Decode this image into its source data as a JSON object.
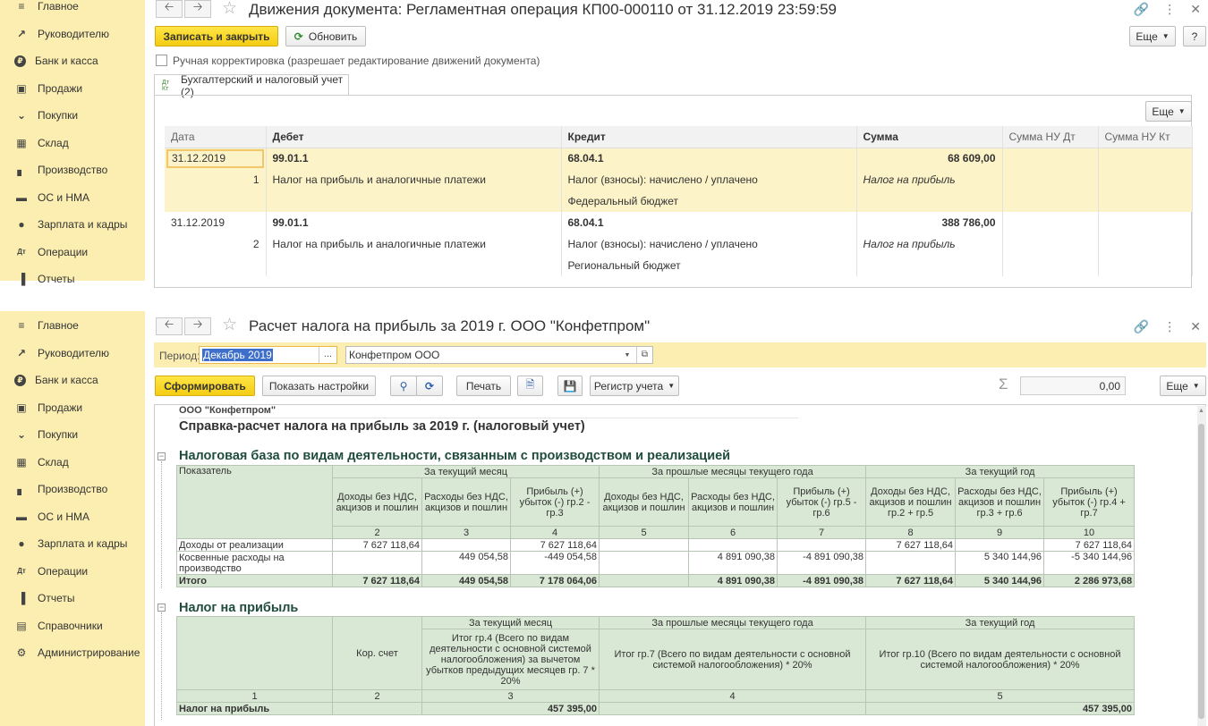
{
  "sidebar_top": [
    "Главное",
    "Руководителю",
    "Банк и касса",
    "Продажи",
    "Покупки",
    "Склад",
    "Производство",
    "ОС и НМА",
    "Зарплата и кадры",
    "Операции",
    "Отчеты"
  ],
  "sidebar_bottom": [
    "Главное",
    "Руководителю",
    "Банк и касса",
    "Продажи",
    "Покупки",
    "Склад",
    "Производство",
    "ОС и НМА",
    "Зарплата и кадры",
    "Операции",
    "Отчеты",
    "Справочники",
    "Администрирование"
  ],
  "icons": [
    "menu-icon",
    "trend-icon",
    "ruble-icon",
    "bag-icon",
    "cart-icon",
    "grid-icon",
    "factory-icon",
    "truck-icon",
    "person-icon",
    "dt-kt-icon",
    "bar-chart-icon",
    "book-icon",
    "gear-icon"
  ],
  "top": {
    "title": "Движения документа: Регламентная операция КП00-000110 от 31.12.2019 23:59:59",
    "save_close": "Записать и закрыть",
    "refresh": "Обновить",
    "more": "Еще",
    "help": "?",
    "manual_checkbox_label": "Ручная корректировка (разрешает редактирование движений документа)",
    "tab_label": "Бухгалтерский и налоговый учет (2)",
    "tab_icon": "Дт Кт",
    "grid_more": "Еще",
    "columns": [
      "Дата",
      "Дебет",
      "Кредит",
      "Сумма",
      "Сумма НУ Дт",
      "Сумма НУ Кт"
    ],
    "rows": [
      {
        "date": "31.12.2019",
        "debit": "99.01.1",
        "credit": "68.04.1",
        "sum": "68 609,00",
        "num": "1",
        "debit_sub": "Налог на прибыль и аналогичные платежи",
        "credit_sub1": "Налог (взносы): начислено / уплачено",
        "credit_sub2": "Федеральный бюджет",
        "sum_sub": "Налог на прибыль"
      },
      {
        "date": "31.12.2019",
        "debit": "99.01.1",
        "credit": "68.04.1",
        "sum": "388 786,00",
        "num": "2",
        "debit_sub": "Налог на прибыль и аналогичные платежи",
        "credit_sub1": "Налог (взносы): начислено / уплачено",
        "credit_sub2": "Региональный бюджет",
        "sum_sub": "Налог на прибыль"
      }
    ]
  },
  "bottom": {
    "title": "Расчет налога на прибыль за 2019 г. ООО \"Конфетпром\"",
    "period_label": "Период:",
    "period_value": "Декабрь 2019",
    "org_value": "Конфетпром ООО",
    "form_btn": "Сформировать",
    "settings_btn": "Показать настройки",
    "print_btn": "Печать",
    "register_btn": "Регистр учета",
    "sum_value": "0,00",
    "more": "Еще",
    "report": {
      "org": "ООО \"Конфетпром\"",
      "heading": "Справка-расчет налога на прибыль за 2019 г. (налоговый учет)",
      "section1": "Налоговая база по видам деятельности, связанным с производством и реализацией",
      "t1_groups": [
        "За текущий месяц",
        "За прошлые месяцы текущего года",
        "За текущий год"
      ],
      "t1_indicator": "Показатель",
      "t1_subheads": [
        "Доходы без НДС, акцизов и пошлин",
        "Расходы без НДС, акцизов и пошлин",
        "Прибыль (+) убыток (-) гр.2 - гр.3",
        "Доходы без НДС, акцизов и пошлин",
        "Расходы без НДС, акцизов и пошлин",
        "Прибыль (+) убыток (-) гр.5 - гр.6",
        "Доходы без НДС, акцизов и пошлин гр.2 + гр.5",
        "Расходы без НДС, акцизов и пошлин гр.3 + гр.6",
        "Прибыль (+) убыток (-) гр.4 + гр.7"
      ],
      "t1_nums": [
        "2",
        "3",
        "4",
        "5",
        "6",
        "7",
        "8",
        "9",
        "10"
      ],
      "t1_rows": [
        {
          "name": "Доходы от реализации",
          "v": [
            "7 627 118,64",
            "",
            "7 627 118,64",
            "",
            "",
            "",
            "7 627 118,64",
            "",
            "7 627 118,64"
          ]
        },
        {
          "name": "Косвенные расходы на производство",
          "v": [
            "",
            "449 054,58",
            "-449 054,58",
            "",
            "4 891 090,38",
            "-4 891 090,38",
            "",
            "5 340 144,96",
            "-5 340 144,96"
          ]
        }
      ],
      "t1_total": {
        "name": "Итого",
        "v": [
          "7 627 118,64",
          "449 054,58",
          "7 178 064,06",
          "",
          "4 891 090,38",
          "-4 891 090,38",
          "7 627 118,64",
          "5 340 144,96",
          "2 286 973,68"
        ]
      },
      "section2": "Налог на прибыль",
      "t2_groups": [
        "За текущий месяц",
        "За прошлые месяцы текущего года",
        "За текущий год"
      ],
      "t2_kor": "Кор. счет",
      "t2_h3": "Итог гр.4 (Всего по видам деятельности с основной системой налогообложения) за вычетом убытков предыдущих месяцев гр. 7 * 20%",
      "t2_h4": "Итог гр.7 (Всего по видам деятельности с основной системой налогообложения) * 20%",
      "t2_h5": "Итог гр.10 (Всего по видам деятельности с основной системой налогообложения) * 20%",
      "t2_nums": [
        "1",
        "2",
        "3",
        "4",
        "5"
      ],
      "t2_row": {
        "name": "Налог на прибыль",
        "kor": "",
        "v3": "457 395,00",
        "v4": "",
        "v5": "457 395,00"
      }
    }
  }
}
